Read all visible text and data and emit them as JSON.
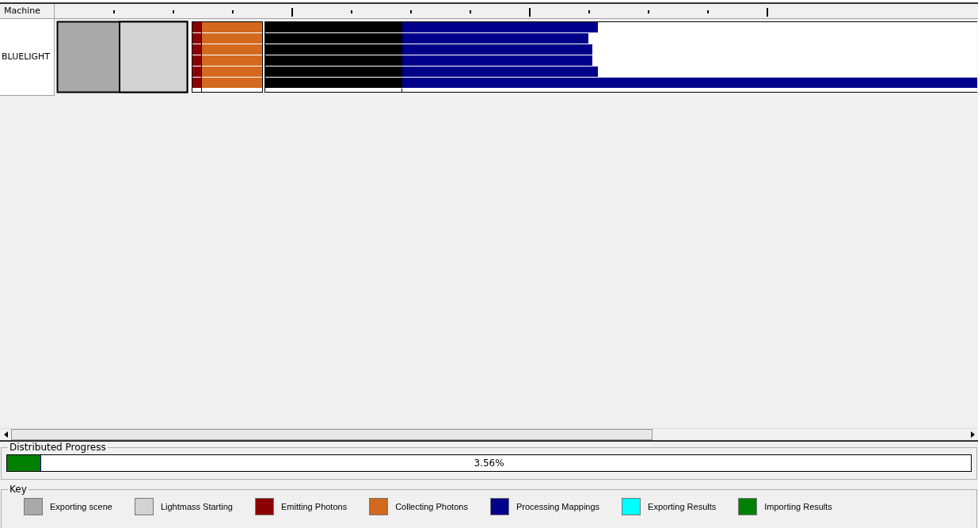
{
  "timeline": {
    "column_header": "Machine",
    "rows": [
      {
        "machine": "BLUELIGHT"
      }
    ]
  },
  "progress": {
    "title": "Distributed Progress",
    "level": 0.0356,
    "reading": "3.56%"
  },
  "key": {
    "title": "Key",
    "items": [
      {
        "label": "Exporting scene",
        "color": "#a9a9a9"
      },
      {
        "label": "Lightmass Starting",
        "color": "#d3d3d3"
      },
      {
        "label": "Emitting Photons",
        "color": "#8b0000"
      },
      {
        "label": "Collecting Photons",
        "color": "#d2691e"
      },
      {
        "label": "Processing Mappings",
        "color": "#00008b"
      },
      {
        "label": "Exporting Results",
        "color": "#00ffff"
      },
      {
        "label": "Importing Results",
        "color": "#008000"
      }
    ]
  }
}
